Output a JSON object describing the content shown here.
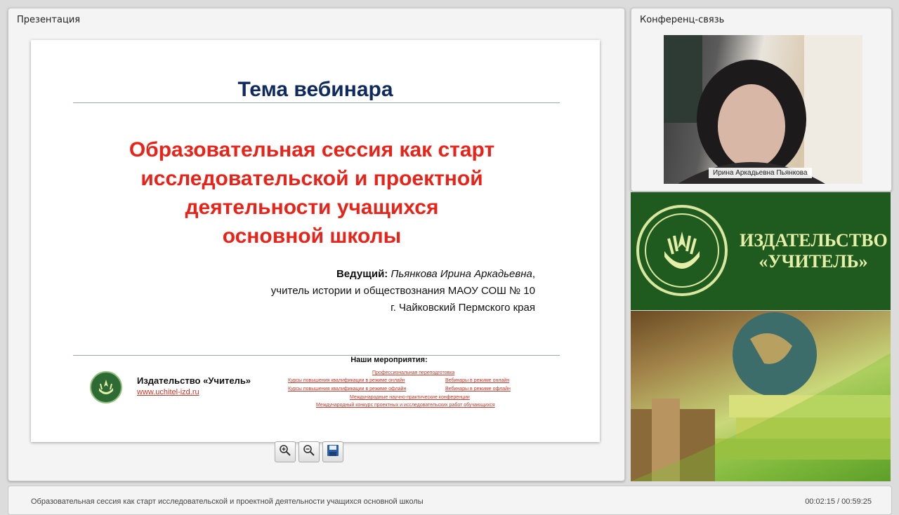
{
  "left_panel": {
    "title": "Презентация"
  },
  "right_panel": {
    "title": "Конференц-связь"
  },
  "slide": {
    "heading": "Тема вебинара",
    "title_lines": [
      "Образовательная сессия как старт",
      "исследовательской и проектной",
      "деятельности учащихся",
      "основной школы"
    ],
    "presenter_label": "Ведущий:",
    "presenter_name": "Пьянкова Ирина Аркадьевна",
    "presenter_comma": ",",
    "presenter_role": "учитель истории и обществознания МАОУ СОШ № 10",
    "presenter_city": "г. Чайковский Пермского края",
    "publisher": "Издательство «Учитель»",
    "publisher_url": "www.uchitel-izd.ru",
    "events_title": "Наши мероприятия:",
    "events": [
      "Профессиональная переподготовка",
      "Курсы повышения квалификации в режиме онлайн",
      "Вебинары в режиме онлайн",
      "Курсы повышения квалификации в режиме офлайн",
      "Вебинары в режиме офлайн",
      "Международные научно-практические конференции",
      "Международный конкурс проектных и исследовательских работ обучающихся"
    ]
  },
  "toolbar": {
    "zoom_in": "zoom-in-icon",
    "zoom_out": "zoom-out-icon",
    "save": "save-icon"
  },
  "video": {
    "participant": "Ирина Аркадьевна Пьянкова"
  },
  "banner": {
    "line1": "ИЗДАТЕЛЬСТВО",
    "line2": "«УЧИТЕЛЬ»"
  },
  "status": {
    "title": "Образовательная сессия как старт исследовательской и проектной деятельности учащихся основной школы",
    "time": "00:02:15 / 00:59:25"
  },
  "colors": {
    "accent_red": "#e8241a",
    "heading_navy": "#0f2a5e",
    "brand_green": "#1f5a1f"
  }
}
